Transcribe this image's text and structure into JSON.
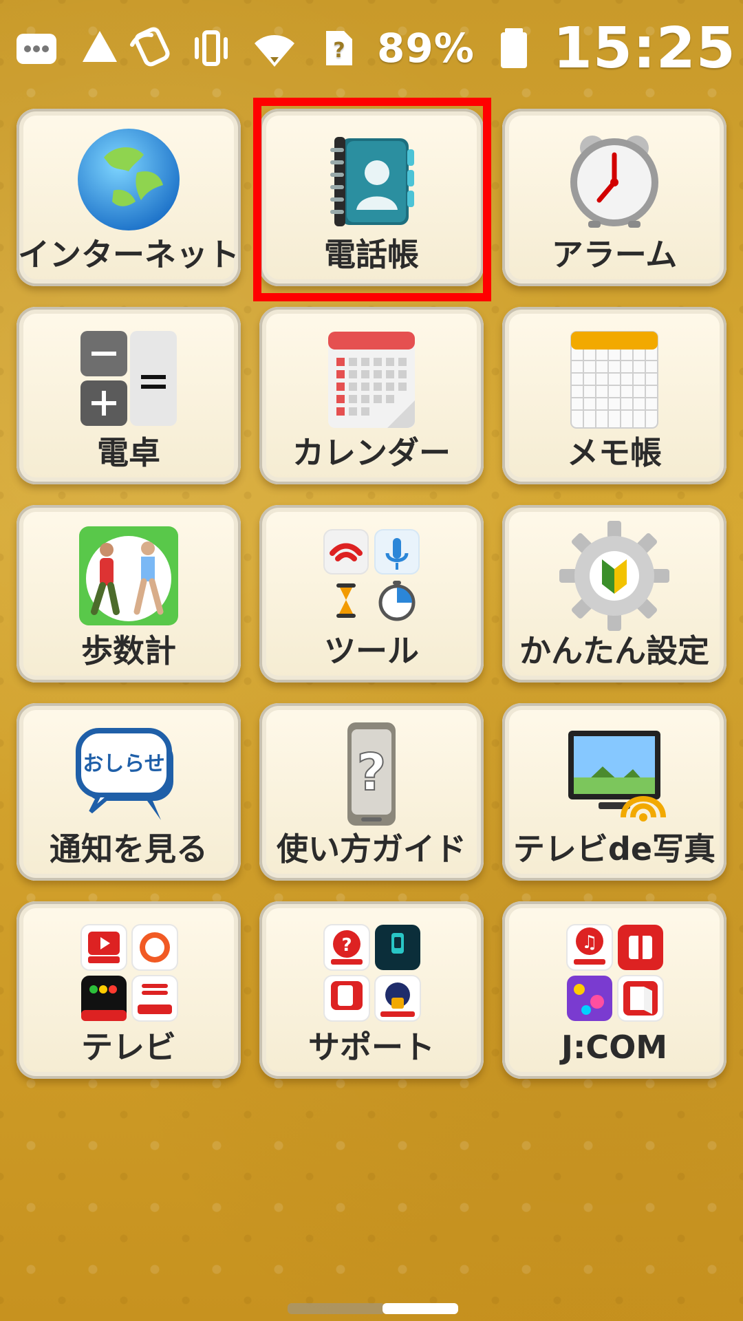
{
  "statusbar": {
    "battery_percent": "89%",
    "time": "15:25",
    "icons_left": [
      "messenger-icon",
      "google-drive-icon"
    ],
    "icons_right": [
      "nfc-icon",
      "vibrate-icon",
      "wifi-icon",
      "no-sim-icon",
      "battery-icon"
    ]
  },
  "tiles": [
    {
      "label": "インターネット",
      "icon": "globe-icon"
    },
    {
      "label": "電話帳",
      "icon": "contacts-book-icon"
    },
    {
      "label": "アラーム",
      "icon": "alarm-clock-icon"
    },
    {
      "label": "電卓",
      "icon": "calculator-icon"
    },
    {
      "label": "カレンダー",
      "icon": "calendar-icon"
    },
    {
      "label": "メモ帳",
      "icon": "memo-grid-icon"
    },
    {
      "label": "歩数計",
      "icon": "pedometer-icon"
    },
    {
      "label": "ツール",
      "icon": "tools-folder-icon"
    },
    {
      "label": "かんたん設定",
      "icon": "settings-gear-icon"
    },
    {
      "label": "通知を見る",
      "icon": "notice-bubble-icon"
    },
    {
      "label": "使い方ガイド",
      "icon": "help-phone-icon"
    },
    {
      "label": "テレビde写真",
      "icon": "tv-photo-icon"
    },
    {
      "label": "テレビ",
      "icon": "tv-folder-icon"
    },
    {
      "label": "サポート",
      "icon": "support-folder-icon"
    },
    {
      "label": "J:COM",
      "icon": "jcom-folder-icon"
    }
  ],
  "notice_icon_text": "おしらせ",
  "colors": {
    "highlight": "#ff0000",
    "background_gold": "#d7a933",
    "tile_face": "#fff9ea"
  }
}
